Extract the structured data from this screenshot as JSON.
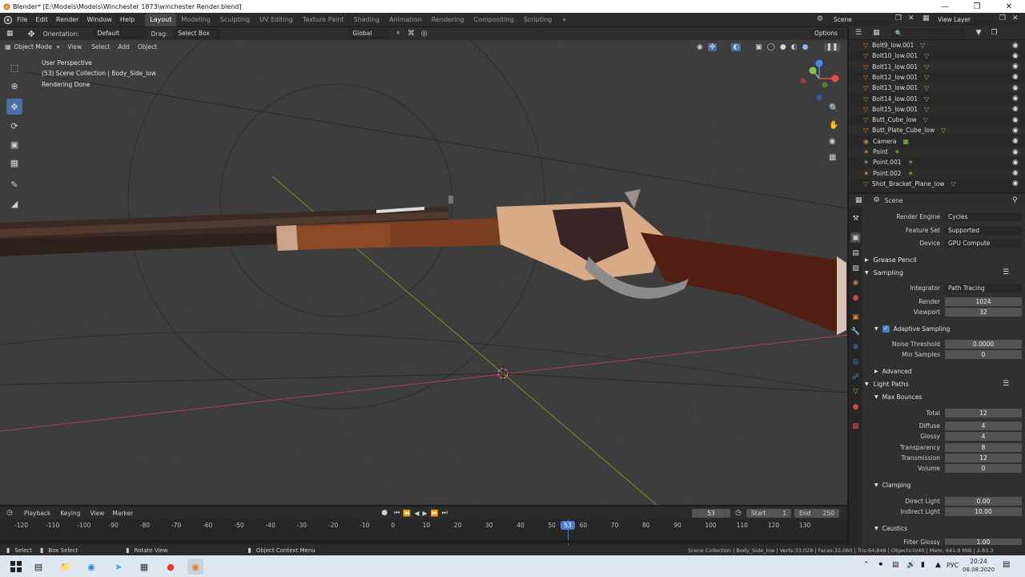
{
  "window": {
    "title": "Blender* [E:\\Models\\Models\\Winchester 1873\\winchester Render.blend]"
  },
  "menu": {
    "items": [
      "File",
      "Edit",
      "Render",
      "Window",
      "Help"
    ]
  },
  "workspaces": {
    "tabs": [
      "Layout",
      "Modeling",
      "Sculpting",
      "UV Editing",
      "Texture Paint",
      "Shading",
      "Animation",
      "Rendering",
      "Compositing",
      "Scripting"
    ],
    "active": "Layout",
    "add": "+"
  },
  "scene": {
    "name": "Scene",
    "view_layer": "View Layer"
  },
  "toolbar": {
    "orientation_label": "Orientation:",
    "orientation_value": "Default",
    "drag_label": "Drag:",
    "drag_value": "Select Box",
    "transform_value": "Global",
    "options_label": "Options"
  },
  "viewport": {
    "mode": "Object Mode",
    "menu": [
      "View",
      "Select",
      "Add",
      "Object"
    ],
    "info": [
      "User Perspective",
      "(53) Scene Collection | Body_Side_low",
      "Rendering Done"
    ]
  },
  "outliner": {
    "search_placeholder": "",
    "rows": [
      "Bolt9_low.001",
      "Bolt10_low.001",
      "Bolt11_low.001",
      "Bolt12_low.001",
      "Bolt13_low.001",
      "Bolt14_low.001",
      "Bolt15_low.001",
      "Butt_Cube_low",
      "Butt_Plate_Cube_low",
      "Camera",
      "Point",
      "Point.001",
      "Point.002",
      "Shot_Bracket_Plane_low"
    ]
  },
  "properties": {
    "context": "Scene",
    "render_engine_label": "Render Engine",
    "render_engine": "Cycles",
    "feature_set_label": "Feature Set",
    "feature_set": "Supported",
    "device_label": "Device",
    "device": "GPU Compute",
    "grease_pencil": "Grease Pencil",
    "sampling": "Sampling",
    "integrator_label": "Integrator",
    "integrator": "Path Tracing",
    "render_label": "Render",
    "render_samples": "1024",
    "viewport_label": "Viewport",
    "viewport_samples": "32",
    "adaptive_sampling": "Adaptive Sampling",
    "noise_threshold_label": "Noise Threshold",
    "noise_threshold": "0.0000",
    "min_samples_label": "Min Samples",
    "min_samples": "0",
    "advanced": "Advanced",
    "light_paths": "Light Paths",
    "max_bounces": "Max Bounces",
    "total_label": "Total",
    "total": "12",
    "diffuse_label": "Diffuse",
    "diffuse": "4",
    "glossy_label": "Glossy",
    "glossy": "4",
    "transparency_label": "Transparency",
    "transparency": "8",
    "transmission_label": "Transmission",
    "transmission": "12",
    "volume_label": "Volume",
    "volume": "0",
    "clamping": "Clamping",
    "direct_light_label": "Direct Light",
    "direct_light": "0.00",
    "indirect_light_label": "Indirect Light",
    "indirect_light": "10.00",
    "caustics": "Caustics",
    "filter_glossy_label": "Filter Glossy",
    "filter_glossy": "1.00"
  },
  "timeline": {
    "menu": [
      "Playback",
      "Keying",
      "View",
      "Marker"
    ],
    "current_frame": "53",
    "start_label": "Start",
    "start": "1",
    "end_label": "End",
    "end": "250",
    "ticks": [
      "-120",
      "-110",
      "-100",
      "-90",
      "-80",
      "-70",
      "-60",
      "-50",
      "-40",
      "-30",
      "-20",
      "-10",
      "0",
      "10",
      "20",
      "30",
      "40",
      "50",
      "60",
      "70",
      "80",
      "90",
      "100",
      "110",
      "120",
      "130"
    ],
    "playhead": "53"
  },
  "statusbar": {
    "select": "Select",
    "box_select": "Box Select",
    "rotate_view": "Rotate View",
    "context_menu": "Object Context Menu",
    "stats": "Scene Collection | Body_Side_low | Verts:33,028 | Faces:32,060 | Tris:64,848 | Objects:0/40 | Mem: 641.9 MiB | 2.83.3"
  },
  "taskbar": {
    "lang": "РУС",
    "time": "20:24",
    "date": "08.08.2020"
  },
  "colors": {
    "accent": "#4a6fa5",
    "axis_x": "#b0444e",
    "axis_y": "#6c9a24",
    "bg": "#3d3d3d"
  }
}
